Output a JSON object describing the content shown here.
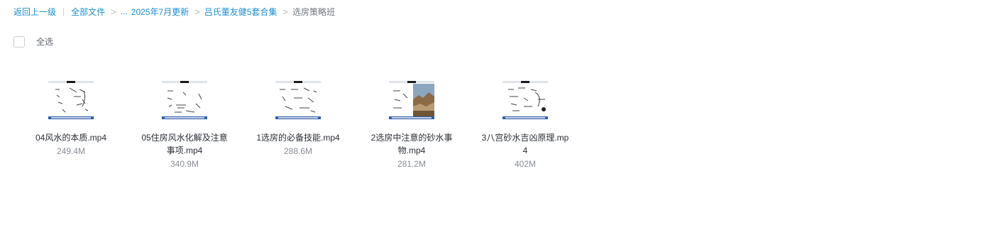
{
  "breadcrumb": {
    "back": "返回上一级",
    "all_files": "全部文件",
    "ellipsis": "...",
    "folder_1": "2025年7月更新",
    "folder_2": "吕氏董友健5套合集",
    "current": "选房策略班"
  },
  "select_all": {
    "label": "全选"
  },
  "files": [
    {
      "name": "04风水的本质.mp4",
      "size": "249.4M",
      "thumb": "video-thumbnail-icon"
    },
    {
      "name": "05住房风水化解及注意事项.mp4",
      "size": "340.9M",
      "thumb": "video-thumbnail-icon"
    },
    {
      "name": "1选房的必备技能.mp4",
      "size": "288.6M",
      "thumb": "video-thumbnail-icon"
    },
    {
      "name": "2选房中注意的砂水事物.mp4",
      "size": "281.2M",
      "thumb": "video-thumbnail-icon"
    },
    {
      "name": "3八宫砂水吉凶原理.mp4",
      "size": "402M",
      "thumb": "video-thumbnail-icon"
    }
  ],
  "colors": {
    "link": "#1a8ed3",
    "text": "#2b2f36",
    "muted": "#878d96"
  }
}
